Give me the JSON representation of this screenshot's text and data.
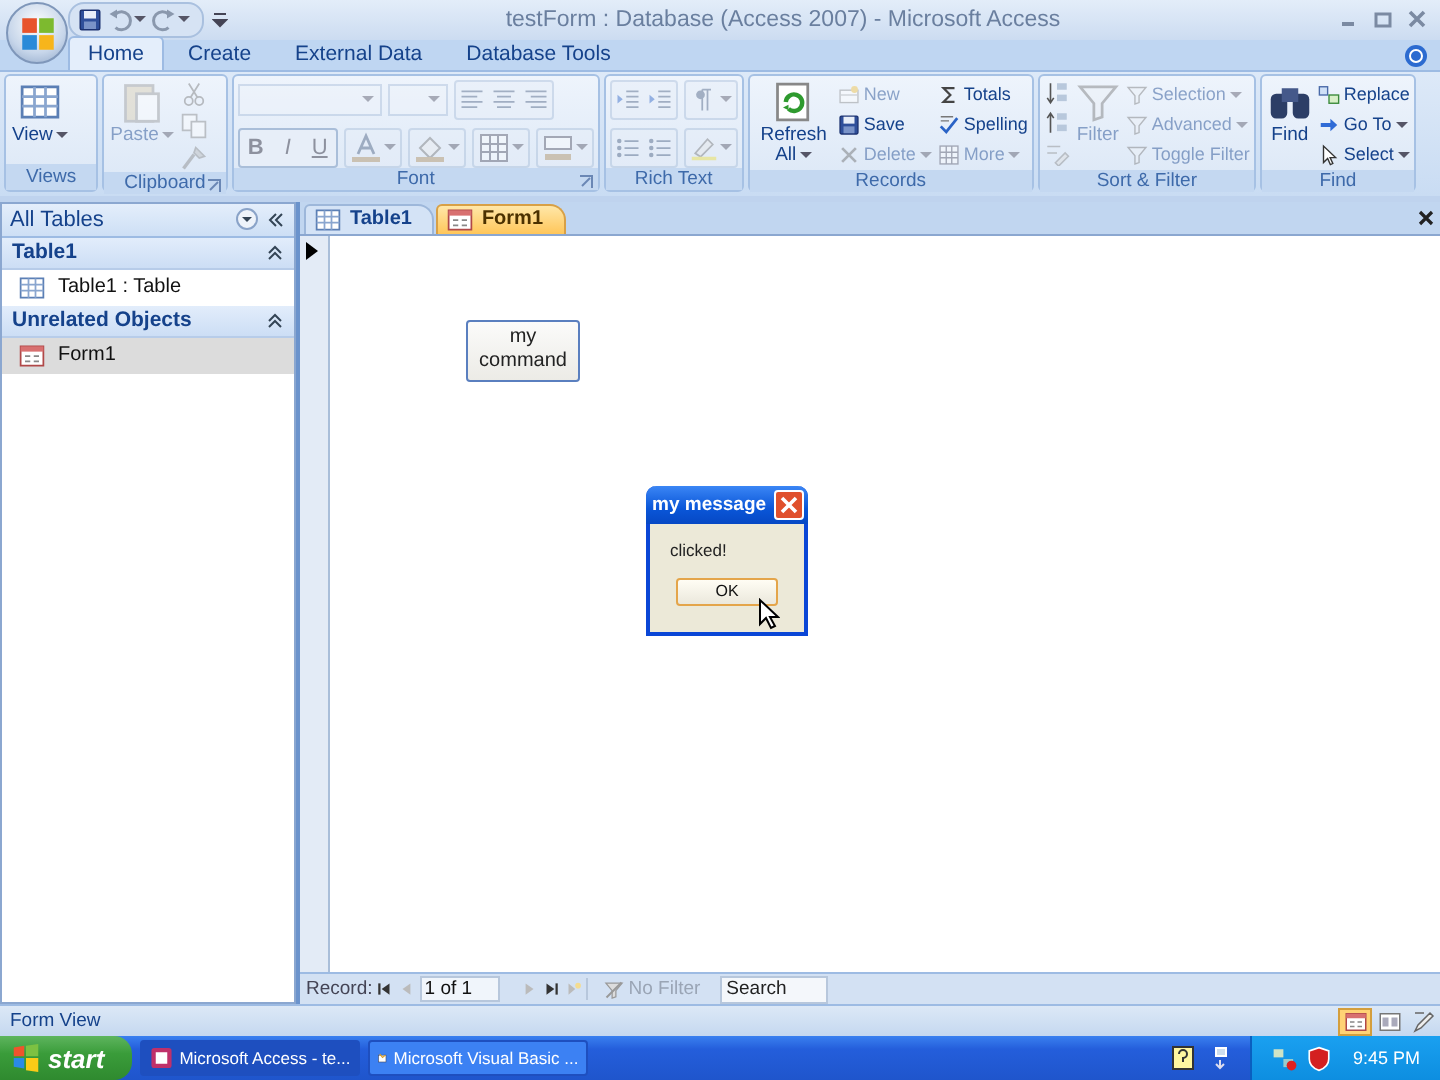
{
  "title_bar": {
    "title": "testForm : Database (Access 2007) - Microsoft Access"
  },
  "ribbon_tabs": [
    {
      "label": "Home",
      "selected": true
    },
    {
      "label": "Create",
      "selected": false
    },
    {
      "label": "External Data",
      "selected": false
    },
    {
      "label": "Database Tools",
      "selected": false
    }
  ],
  "ribbon_groups": [
    {
      "kind": "views",
      "label": "Views",
      "items": [
        {
          "label": "View",
          "disabled": false
        }
      ]
    },
    {
      "kind": "clipboard",
      "label": "Clipboard",
      "launcher": true,
      "items": [
        {
          "label": "Paste",
          "disabled": true
        }
      ]
    },
    {
      "kind": "font",
      "label": "Font",
      "launcher": true,
      "items": [
        {
          "label": "B",
          "disabled": true
        },
        {
          "label": "I",
          "disabled": true
        },
        {
          "label": "U",
          "disabled": true
        }
      ]
    },
    {
      "kind": "richtext",
      "label": "Rich Text"
    },
    {
      "kind": "records",
      "label": "Records",
      "items": [
        {
          "label": "Refresh All",
          "disabled": false
        },
        {
          "label": "New",
          "disabled": true
        },
        {
          "label": "Save",
          "disabled": false
        },
        {
          "label": "Delete",
          "disabled": true
        },
        {
          "label": "Totals",
          "disabled": false
        },
        {
          "label": "Spelling",
          "disabled": false
        },
        {
          "label": "More",
          "disabled": true
        }
      ]
    },
    {
      "kind": "sortfilter",
      "label": "Sort & Filter",
      "items": [
        {
          "label": "Filter",
          "disabled": true
        },
        {
          "label": "Selection",
          "disabled": true
        },
        {
          "label": "Advanced",
          "disabled": true
        },
        {
          "label": "Toggle Filter",
          "disabled": true
        }
      ]
    },
    {
      "kind": "find",
      "label": "Find",
      "items": [
        {
          "label": "Find",
          "disabled": false
        },
        {
          "label": "Replace",
          "disabled": false
        },
        {
          "label": "Go To",
          "disabled": false
        },
        {
          "label": "Select",
          "disabled": false
        }
      ]
    }
  ],
  "nav_pane": {
    "title": "All Tables",
    "groups": [
      {
        "label": "Table1",
        "expanded": true,
        "items": [
          {
            "label": "Table1 : Table",
            "kind": "table",
            "selected": false
          }
        ]
      },
      {
        "label": "Unrelated Objects",
        "expanded": true,
        "items": [
          {
            "label": "Form1",
            "kind": "form",
            "selected": true
          }
        ]
      }
    ]
  },
  "document_tabs": [
    {
      "label": "Table1",
      "kind": "table",
      "selected": false
    },
    {
      "label": "Form1",
      "kind": "form",
      "selected": true
    }
  ],
  "form": {
    "command_button": "my command",
    "dialog": {
      "title": "my message",
      "message": "clicked!",
      "button": "OK"
    }
  },
  "record_nav": {
    "label": "Record:",
    "position": "1 of 1",
    "filter": "No Filter",
    "search_placeholder": "Search"
  },
  "status_bar": {
    "text": "Form View",
    "views": [
      {
        "kind": "form",
        "selected": true
      },
      {
        "kind": "layout",
        "selected": false
      },
      {
        "kind": "design",
        "selected": false
      }
    ]
  },
  "taskbar": {
    "start": "start",
    "tasks": [
      {
        "label": "Microsoft Access - te...",
        "kind": "access",
        "selected": true
      },
      {
        "label": "Microsoft Visual Basic ...",
        "kind": "vba",
        "selected": false
      }
    ],
    "clock": "9:45 PM"
  }
}
